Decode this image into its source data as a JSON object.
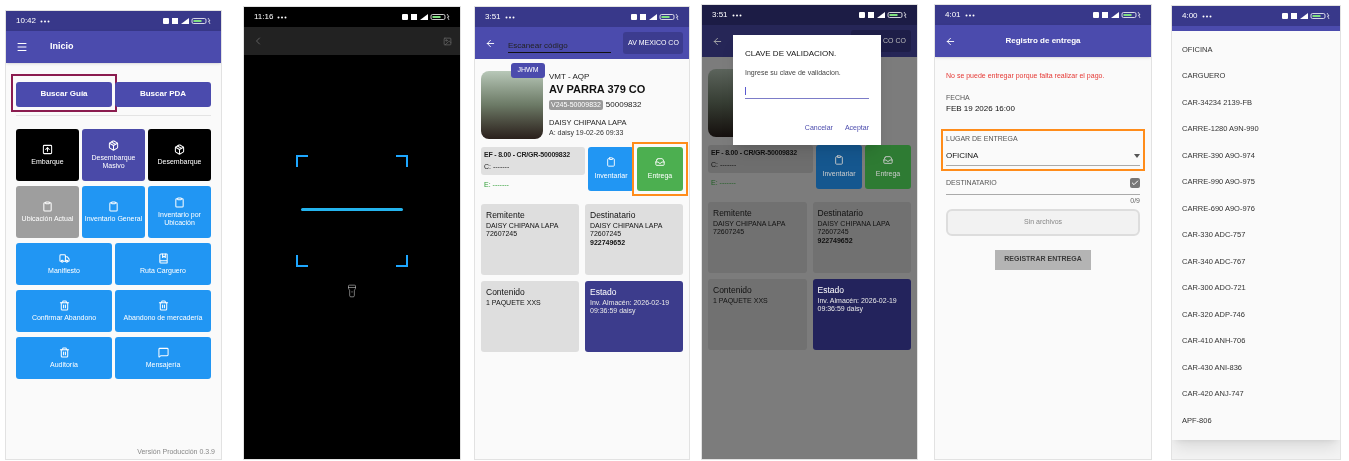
{
  "screens": [
    {
      "kind": "home",
      "status_time": "10:42",
      "title": "Inicio",
      "search_buttons": [
        {
          "label": "Buscar Guía",
          "highlighted": true
        },
        {
          "label": "Buscar PDA",
          "highlighted": false
        }
      ],
      "tile_rows": [
        [
          {
            "label": "Embarque",
            "kind": "upload",
            "color": "#000000"
          },
          {
            "label": "Desembarque Masivo",
            "kind": "box",
            "color": "#4a4aa8"
          },
          {
            "label": "Desembarque",
            "kind": "box",
            "color": "#000000"
          }
        ],
        [
          {
            "label": "Ubicación Actual",
            "kind": "clipboard",
            "color": "#9e9e9e"
          },
          {
            "label": "Inventario General",
            "kind": "clipboard",
            "color": "#2196f3"
          },
          {
            "label": "Inventario por Ubicación",
            "kind": "clipboard",
            "color": "#2196f3"
          }
        ],
        [
          {
            "label": "Manifiesto",
            "kind": "truck",
            "color": "#2196f3"
          },
          {
            "label": "Ruta Carguero",
            "kind": "book",
            "color": "#2196f3"
          }
        ],
        [
          {
            "label": "Confirmar Abandono",
            "kind": "trash",
            "color": "#2196f3"
          },
          {
            "label": "Abandono de mercadería",
            "kind": "trash",
            "color": "#2196f3"
          }
        ],
        [
          {
            "label": "Auditoría",
            "kind": "trash",
            "color": "#2196f3"
          },
          {
            "label": "Mensajería",
            "kind": "chat",
            "color": "#2196f3"
          }
        ]
      ],
      "footer": "Versión Producción 0.3.9"
    },
    {
      "kind": "scanner",
      "status_time": "11:16"
    },
    {
      "kind": "detail",
      "status_time": "3:51",
      "search": {
        "placeholder": "Escanear código"
      },
      "office_button": "AV MEXICO CO",
      "badge": "JHWM",
      "route": "VMT - AQP",
      "address": "AV PARRA 379 CO",
      "guide_chip": "V245-50009832",
      "guide_number": "50009832",
      "person": "DAISY CHIPANA LAPA",
      "audit": "A: daisy 19-02-26 09:33",
      "summary": [
        "EF - 8.00 - CR/GR-50009832",
        "C: -------"
      ],
      "e_line": "E: -------",
      "actions": [
        {
          "label": "Inventariar",
          "kind": "clipboard",
          "color": "#2196f3",
          "highlighted": false
        },
        {
          "label": "Entrega",
          "kind": "inbox",
          "color": "#4caf50",
          "highlighted": true
        }
      ],
      "cards": [
        {
          "title": "Remitente",
          "color": "#dedede",
          "lines": [
            {
              "text": "DAISY CHIPANA LAPA",
              "bold": false
            },
            {
              "text": "72607245",
              "bold": false
            }
          ]
        },
        {
          "title": "Destinatario",
          "color": "#dedede",
          "lines": [
            {
              "text": "DAISY CHIPANA LAPA",
              "bold": false
            },
            {
              "text": "72607245",
              "bold": false
            },
            {
              "text": "922749652",
              "bold": true
            }
          ]
        },
        {
          "title": "Contenido",
          "color": "#dedede",
          "lines": [
            {
              "text": "1 PAQUETE XXS",
              "bold": false
            }
          ]
        },
        {
          "title": "Estado",
          "color": "#3c3c8c",
          "lines": [
            {
              "text": "Inv. Almacén: 2026-02-19 09:36:59 daisy",
              "bold": false
            }
          ]
        }
      ]
    },
    {
      "kind": "detail",
      "status_time": "3:51",
      "office_button": "CO CO",
      "summary": [
        "EF - 8.00 - CR/GR-50009832",
        "C: -------"
      ],
      "e_line": "E: -------",
      "actions": [
        {
          "label": "Inventariar",
          "kind": "clipboard",
          "color": "#15578f",
          "highlighted": false
        },
        {
          "label": "Entrega",
          "kind": "inbox",
          "color": "#2e7b33",
          "highlighted": false
        }
      ],
      "cards": [
        {
          "title": "Remitente",
          "color": "#717171",
          "lines": [
            {
              "text": "DAISY CHIPANA LAPA",
              "bold": false
            },
            {
              "text": "72607245",
              "bold": false
            }
          ]
        },
        {
          "title": "Destinatario",
          "color": "#717171",
          "lines": [
            {
              "text": "DAISY CHIPANA LAPA",
              "bold": false
            },
            {
              "text": "72607245",
              "bold": false
            },
            {
              "text": "922749652",
              "bold": true
            }
          ]
        },
        {
          "title": "Contenido",
          "color": "#717171",
          "lines": [
            {
              "text": "1 PAQUETE XXS",
              "bold": false
            }
          ]
        },
        {
          "title": "Estado",
          "color": "#23235c",
          "lines": [
            {
              "text": "Inv. Almacén: 2026-02-19 09:36:59 daisy",
              "bold": false
            }
          ]
        }
      ],
      "dialog": {
        "title": "CLAVE DE VALIDACION.",
        "message": "Ingrese su clave de validacion.",
        "buttons": [
          "Cancelar",
          "Aceptar"
        ]
      }
    },
    {
      "kind": "form",
      "status_time": "4:01",
      "title": "Registro de entrega",
      "error": "No se puede entregar porque falta realizar el pago.",
      "date_label": "FECHA",
      "date": "FEB 19 2026 16:00",
      "place": {
        "label": "LUGAR DE ENTREGA",
        "value": "OFICINA",
        "highlighted": true
      },
      "recipient": {
        "label": "DESTINATARIO",
        "checked": true
      },
      "counter": "0/9",
      "files": "Sin archivos",
      "submit": {
        "label": "REGISTRAR ENTREGA",
        "disabled": true
      }
    },
    {
      "kind": "picker",
      "status_time": "4:00",
      "options": [
        "OFICINA",
        "CARGUERO",
        "CAR-34234 2139-FB",
        "CARRE-1280 A9N-990",
        "CARRE-390 A9O-974",
        "CARRE-990 A9O-975",
        "CARRE-690 A9O-976",
        "CAR-330 ADC-757",
        "CAR-340 ADC-767",
        "CAR-300 ADO-721",
        "CAR-320 ADP-746",
        "CAR-410 ANH-706",
        "CAR-430 ANI-836",
        "CAR-420 ANJ-747",
        "APF-806"
      ]
    }
  ]
}
